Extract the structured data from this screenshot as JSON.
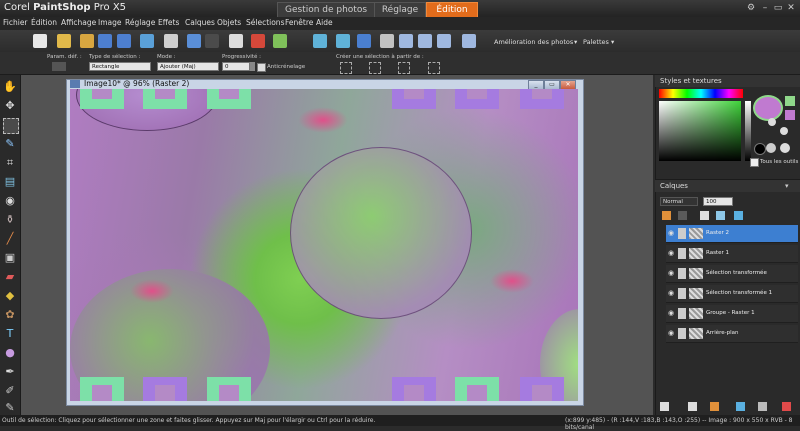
{
  "window": {
    "title_prefix": "Corel ",
    "title_bold": "PaintShop",
    "title_suffix": " Pro X5",
    "tabs": [
      {
        "label": "Gestion de photos",
        "active": false
      },
      {
        "label": "Réglage",
        "active": false
      },
      {
        "label": "Édition",
        "active": true
      }
    ]
  },
  "menu": [
    "Fichier",
    "Édition",
    "Affichage",
    "Image",
    "Réglage",
    "Effets",
    "Calques",
    "Objets",
    "Sélections",
    "Fenêtre",
    "Aide"
  ],
  "toolbar": {
    "enhance_label": "Amélioration des photos",
    "palettes_label": "Palettes"
  },
  "options": {
    "presets_label": "Param. déf. :",
    "selection_type_label": "Type de sélection :",
    "selection_type_value": "Rectangle",
    "mode_label": "Mode :",
    "mode_value": "Ajouter (Maj)",
    "feather_label": "Progressivité :",
    "feather_value": "0",
    "antialias_label": "Anticrénelage",
    "create_from_label": "Créer une sélection à partir de :"
  },
  "document": {
    "title": "Image10* @  96% (Raster 2)"
  },
  "styles_panel": {
    "title": "Styles et textures",
    "all_tools_label": "Tous les outils",
    "foreground_color": "#8fd88a",
    "background_color": "#c07ad0"
  },
  "layers_panel": {
    "title": "Calques",
    "blend_mode": "Normal",
    "opacity": "100",
    "layers": [
      {
        "name": "Raster 2",
        "selected": true
      },
      {
        "name": "Raster 1",
        "selected": false
      },
      {
        "name": "Sélection transformée",
        "selected": false
      },
      {
        "name": "Sélection transformée 1",
        "selected": false
      },
      {
        "name": "Groupe - Raster 1",
        "selected": false
      },
      {
        "name": "Arrière-plan",
        "selected": false
      }
    ]
  },
  "status": {
    "left": "Outil de sélection: Cliquez pour sélectionner une zone et faites glisser. Appuyez sur Maj pour l'élargir ou Ctrl pour la réduire.",
    "right": "(x:899 y:485) - (R :144,V :183,B :143,O :255) -- Image :  900 x 550 x RVB - 8 bits/canal"
  }
}
